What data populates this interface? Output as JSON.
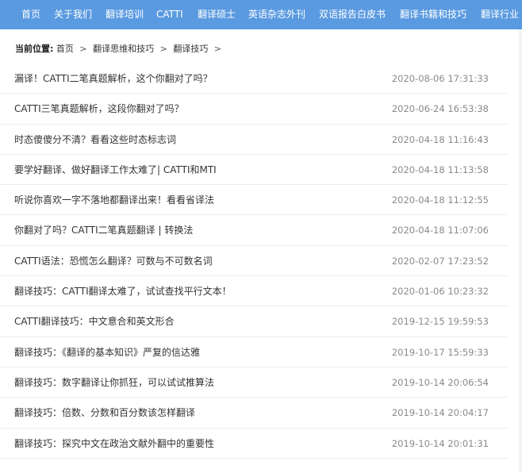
{
  "nav": {
    "items": [
      "首页",
      "关于我们",
      "翻译培训",
      "CATTI",
      "翻译硕士",
      "英语杂志外刊",
      "双语报告白皮书",
      "翻译书籍和技巧",
      "翻译行业"
    ]
  },
  "breadcrumb": {
    "label": "当前位置:",
    "items": [
      "首页",
      "翻译思维和技巧",
      "翻译技巧"
    ],
    "separator": ">"
  },
  "articles": [
    {
      "title": "漏译！CATTI二笔真题解析，这个你翻对了吗？",
      "date": "2020-08-06 17:31:33"
    },
    {
      "title": "CATTI三笔真题解析，这段你翻对了吗？",
      "date": "2020-06-24 16:53:38"
    },
    {
      "title": "时态傻傻分不清？看看这些时态标志词",
      "date": "2020-04-18 11:16:43"
    },
    {
      "title": "要学好翻译、做好翻译工作太难了| CATTI和MTI",
      "date": "2020-04-18 11:13:58"
    },
    {
      "title": "听说你喜欢一字不落地都翻译出来！看看省译法",
      "date": "2020-04-18 11:12:55"
    },
    {
      "title": "你翻对了吗？CATTI二笔真题翻译 | 转换法",
      "date": "2020-04-18 11:07:06"
    },
    {
      "title": "CATTI语法：恐慌怎么翻译？可数与不可数名词",
      "date": "2020-02-07 17:23:52"
    },
    {
      "title": "翻译技巧：CATTI翻译太难了，试试查找平行文本！",
      "date": "2020-01-06 10:23:32"
    },
    {
      "title": "CATTI翻译技巧：中文意合和英文形合",
      "date": "2019-12-15 19:59:53"
    },
    {
      "title": "翻译技巧：《翻译的基本知识》严复的信达雅",
      "date": "2019-10-17 15:59:33"
    },
    {
      "title": "翻译技巧：数字翻译让你抓狂，可以试试推算法",
      "date": "2019-10-14 20:06:54"
    },
    {
      "title": "翻译技巧：倍数、分数和百分数该怎样翻译",
      "date": "2019-10-14 20:04:17"
    },
    {
      "title": "翻译技巧：探究中文在政治文献外翻中的重要性",
      "date": "2019-10-14 20:01:31"
    }
  ],
  "colors": {
    "nav_background": "#5a9ae0",
    "nav_text": "#ffffff",
    "title_text": "#333333",
    "date_text": "#8a8a8a"
  }
}
